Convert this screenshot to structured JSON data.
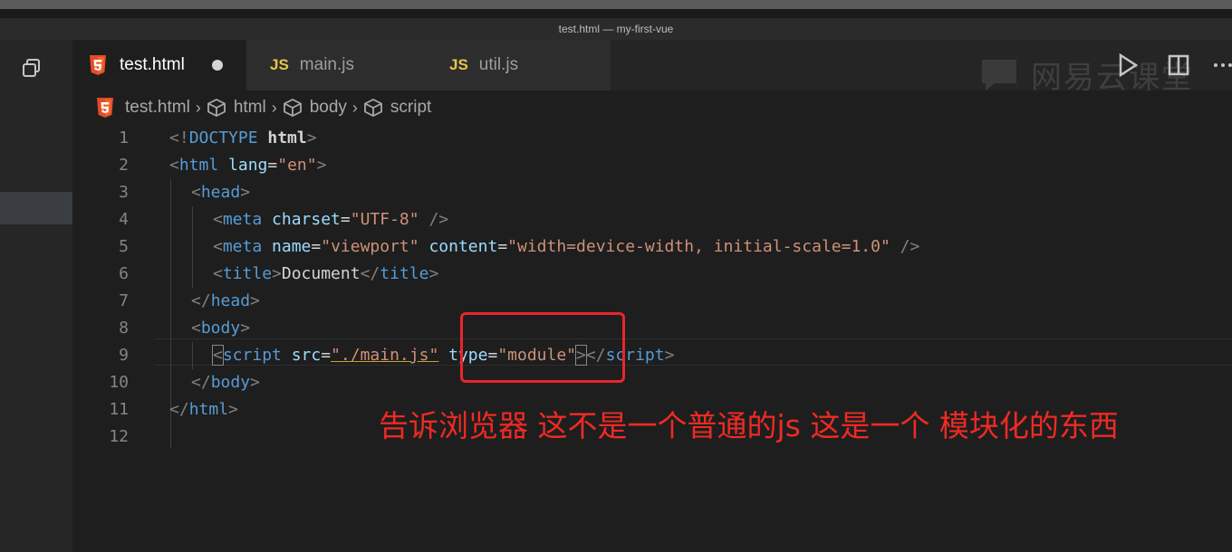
{
  "window": {
    "title": "test.html — my-first-vue"
  },
  "tabs": [
    {
      "label": "test.html",
      "icon": "html5-icon",
      "active": true,
      "modified": true
    },
    {
      "label": "main.js",
      "badge": "JS",
      "active": false
    },
    {
      "label": "util.js",
      "badge": "JS",
      "active": false
    }
  ],
  "breadcrumb": [
    "test.html",
    "html",
    "body",
    "script"
  ],
  "editor": {
    "line_numbers": [
      "1",
      "2",
      "3",
      "4",
      "5",
      "6",
      "7",
      "8",
      "9",
      "10",
      "11",
      "12"
    ],
    "code": {
      "l1": {
        "open": "<!",
        "kw": "DOCTYPE",
        "rest": " html",
        "close": ">"
      },
      "l2": {
        "open": "<",
        "tag": "html",
        "attr": " lang",
        "eq": "=",
        "val": "\"en\"",
        "close": ">"
      },
      "l3": {
        "open": "<",
        "tag": "head",
        "close": ">"
      },
      "l4": {
        "open": "<",
        "tag": "meta",
        "attr": " charset",
        "eq": "=",
        "val": "\"UTF-8\"",
        "close": " />"
      },
      "l5": {
        "open": "<",
        "tag": "meta",
        "attr1": " name",
        "eq1": "=",
        "val1": "\"viewport\"",
        "attr2": " content",
        "eq2": "=",
        "val2": "\"width=device-width, initial-scale=1.0\"",
        "close": " />"
      },
      "l6": {
        "open": "<",
        "tag": "title",
        "close": ">",
        "text": "Document",
        "open2": "</",
        "tag2": "title",
        "close2": ">"
      },
      "l7": {
        "open": "</",
        "tag": "head",
        "close": ">"
      },
      "l8": {
        "open": "<",
        "tag": "body",
        "close": ">"
      },
      "l9": {
        "open": "<",
        "tag": "script",
        "attr1": " src",
        "eq1": "=",
        "val1": "\"./main.js\"",
        "attr2": " type",
        "eq2": "=",
        "val2": "\"module\"",
        "close": ">",
        "open2": "</",
        "tag2": "script",
        "close2": ">"
      },
      "l10": {
        "open": "</",
        "tag": "body",
        "close": ">"
      },
      "l11": {
        "open": "</",
        "tag": "html",
        "close": ">"
      }
    }
  },
  "watermark": {
    "text": "网易云课堂"
  },
  "annotation": {
    "text": "告诉浏览器 这不是一个普通的js 这是一个 模块化的东西"
  },
  "colors": {
    "annotation": "#ee2a24",
    "highlight_box": "#e8262b",
    "js_badge": "#e8c547",
    "html5_icon": "#e34c26"
  }
}
